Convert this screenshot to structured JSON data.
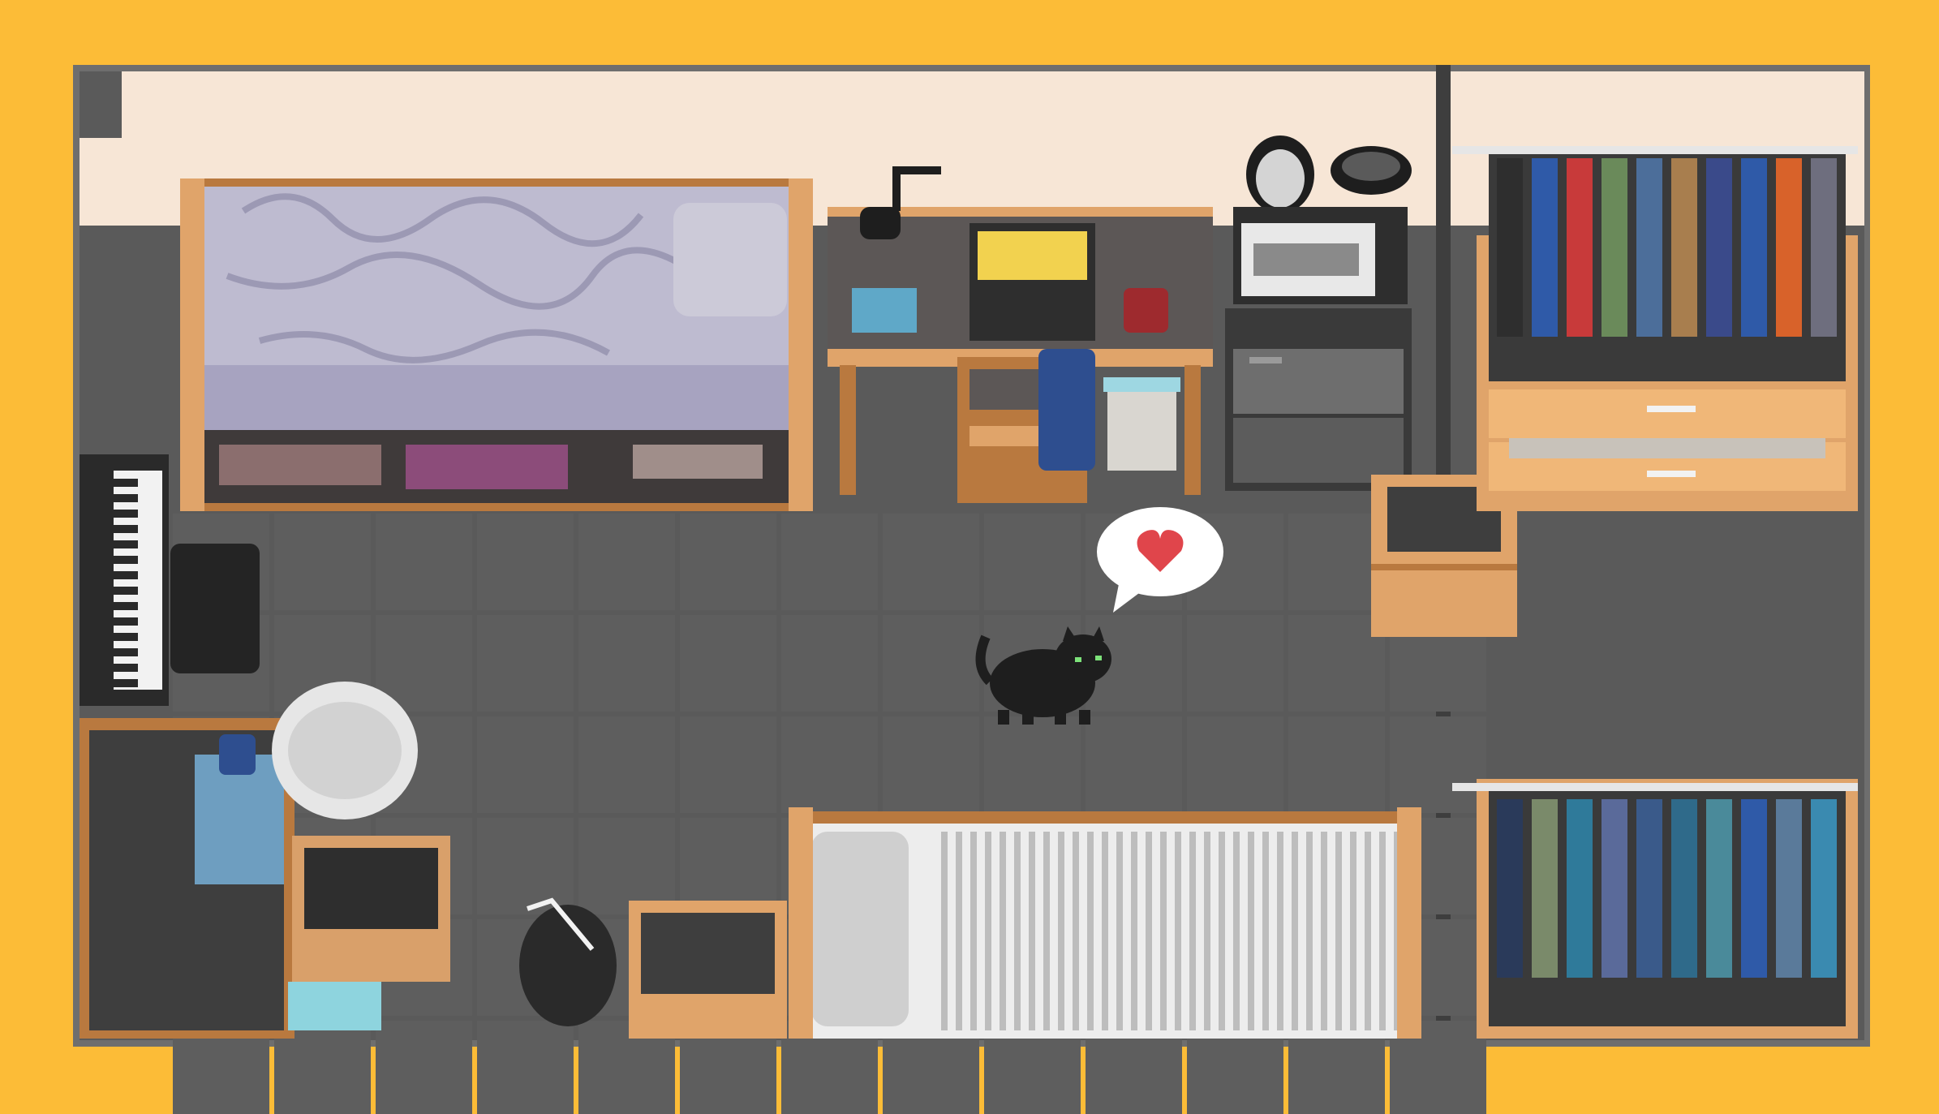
{
  "game": {
    "title": "",
    "scene": "dorm-room",
    "speech_bubble_icon": "heart-icon",
    "player_character": "black-cat"
  },
  "colors": {
    "background": "#FCBC37",
    "frame": "#6E6E6E",
    "wall": "#F7E6D6",
    "floor": "#5A5A5A",
    "floor_dark": "#4A4A4A",
    "wood": "#E0A46A",
    "wood_dark": "#B9793F",
    "heart": "#E0454B"
  },
  "objects": {
    "left_bed": "unmade-bed",
    "desk": "study-desk",
    "laptop_screen": "#F2D24F",
    "microwave": "microwave-icon",
    "mini_fridge": "fridge-icon",
    "keyboard": "piano-keyboard",
    "wardrobe_top": "clothes-rack",
    "wardrobe_bottom": "clothes-rack",
    "right_bed": "striped-bed",
    "nightstand": "nightstand"
  }
}
